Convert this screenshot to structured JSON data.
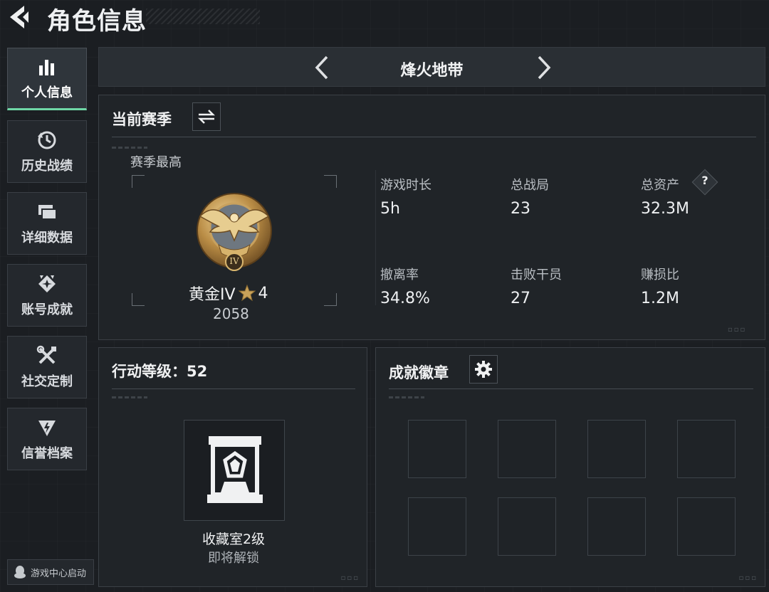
{
  "header": {
    "title": "角色信息",
    "back_icon": "back-arrow-icon"
  },
  "sidebar": {
    "items": [
      {
        "label": "个人信息",
        "icon": "bar-chart-icon",
        "active": true
      },
      {
        "label": "历史战绩",
        "icon": "history-clock-icon",
        "active": false
      },
      {
        "label": "详细数据",
        "icon": "folders-icon",
        "active": false
      },
      {
        "label": "账号成就",
        "icon": "achievement-icon",
        "active": false
      },
      {
        "label": "社交定制",
        "icon": "tools-icon",
        "active": false
      },
      {
        "label": "信誉档案",
        "icon": "credit-shield-icon",
        "active": false
      }
    ],
    "launch_label": "游戏中心启动"
  },
  "mode": {
    "title": "烽火地带"
  },
  "season": {
    "title": "当前赛季",
    "best_label": "赛季最高",
    "rank_name": "黄金IV",
    "rank_stars": "4",
    "rank_score": "2058",
    "rank_badge_numeral": "IV",
    "stats": [
      {
        "label": "游戏时长",
        "value": "5h"
      },
      {
        "label": "总战局",
        "value": "23"
      },
      {
        "label": "总资产",
        "value": "32.3M"
      },
      {
        "label": "撤离率",
        "value": "34.8%"
      },
      {
        "label": "击败干员",
        "value": "27"
      },
      {
        "label": "赚损比",
        "value": "1.2M"
      }
    ],
    "help_glyph": "?"
  },
  "action_level": {
    "title": "行动等级：52",
    "item_name": "收藏室2级",
    "item_status": "即将解锁"
  },
  "badges": {
    "title": "成就徽章",
    "slot_count": 8
  },
  "colors": {
    "accent": "#6fd7a6",
    "gold": "#c9a25a",
    "background": "#1b1e22"
  }
}
